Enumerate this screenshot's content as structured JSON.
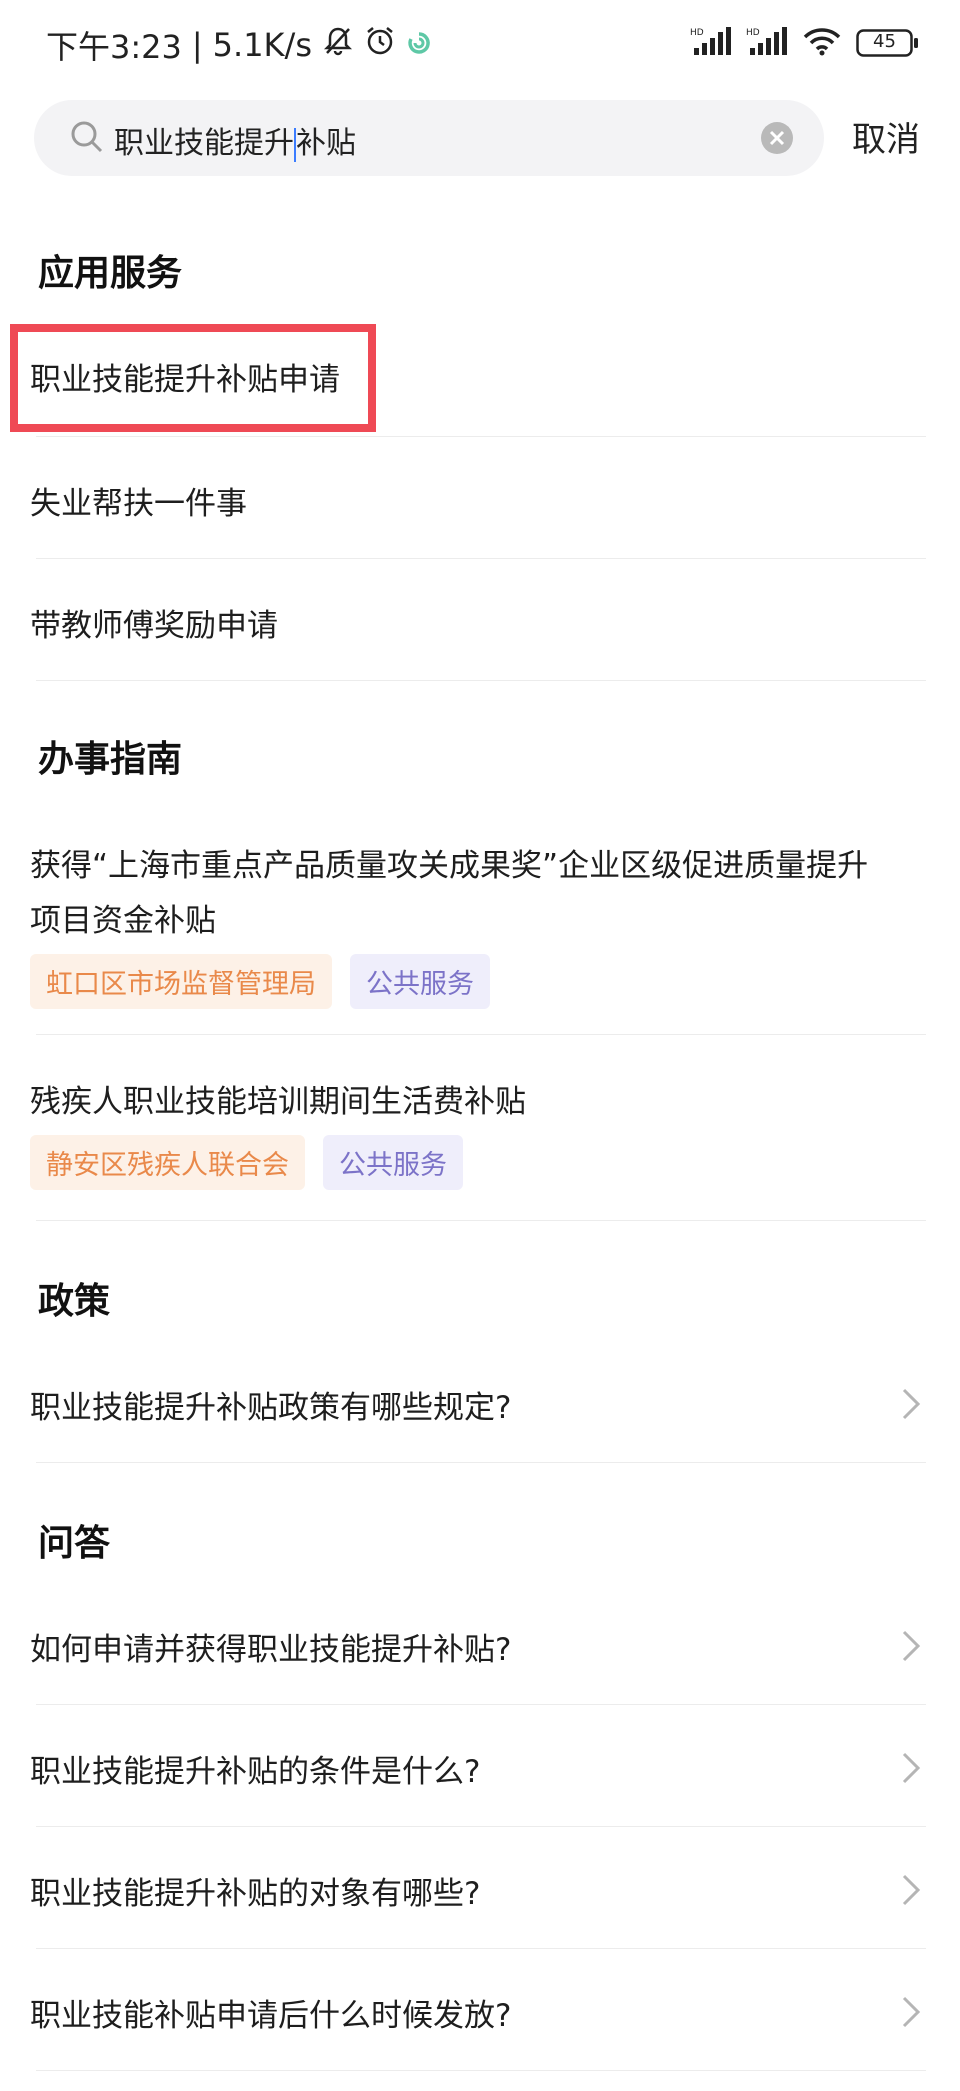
{
  "status": {
    "time": "下午3:23",
    "speed": "5.1K/s",
    "battery": "45",
    "icons": [
      "bell-off-icon",
      "alarm-icon",
      "app-icon",
      "signal-hd-icon",
      "wifi-icon",
      "battery-icon"
    ]
  },
  "search": {
    "query_before_caret": "职业技能提升",
    "query_after_caret": "补贴",
    "cancel": "取消"
  },
  "sections": {
    "apps": {
      "title": "应用服务",
      "items": [
        "职业技能提升补贴申请",
        "失业帮扶一件事",
        "带教师傅奖励申请"
      ]
    },
    "guides": {
      "title": "办事指南",
      "items": [
        {
          "line1": "获得“上海市重点产品质量攻关成果奖”企业区级促进质量提升",
          "line2": "项目资金补贴",
          "org": "虹口区市场监督管理局",
          "category": "公共服务"
        },
        {
          "line1": "残疾人职业技能培训期间生活费补贴",
          "org": "静安区残疾人联合会",
          "category": "公共服务"
        }
      ]
    },
    "policy": {
      "title": "政策",
      "items": [
        "职业技能提升补贴政策有哪些规定?"
      ]
    },
    "qa": {
      "title": "问答",
      "items": [
        "如何申请并获得职业技能提升补贴?",
        "职业技能提升补贴的条件是什么?",
        "职业技能提升补贴的对象有哪些?",
        "职业技能补贴申请后什么时候发放?"
      ]
    }
  },
  "colors": {
    "highlight": "#ef4a55",
    "org_tag_text": "#e9894a",
    "category_tag_text": "#7c73c8"
  }
}
